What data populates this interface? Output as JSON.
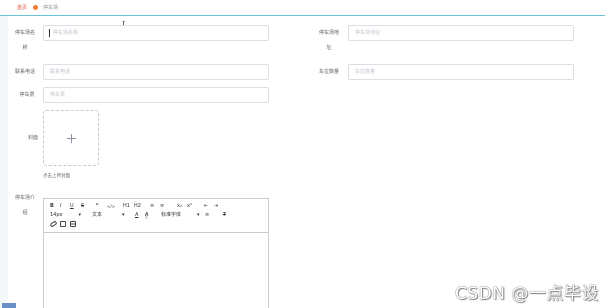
{
  "breadcrumb": {
    "home": "首页",
    "current": "停车场"
  },
  "cursor": "I",
  "form": {
    "name_label": "停车场名称",
    "name_label_line1": "停车场名",
    "name_label_line2": "称",
    "name_placeholder": "停车场名称",
    "addr_label_line1": "停车场地",
    "addr_label_line2": "址",
    "addr_placeholder": "停车场地址",
    "phone_label": "联系电话",
    "phone_placeholder": "联系电话",
    "spots_label": "车位数量",
    "spots_placeholder": "车位数量",
    "fee_label": "停车费",
    "fee_placeholder": "停车费",
    "cover_label": "封面",
    "cover_hint": "点击上传封面",
    "intro_label_line1": "停车场介",
    "intro_label_line2": "绍"
  },
  "editor_toolbar": {
    "bold": "B",
    "italic": "I",
    "underline": "U",
    "strike": "S",
    "quote": "❞",
    "code": "</>",
    "h1": "H1",
    "h2": "H2",
    "ordered": "≡",
    "bullet": "≡",
    "sub": "x₂",
    "sup": "x²",
    "outdent": "⇤",
    "indent": "⇥",
    "size": "14px",
    "header": "文本",
    "color": "A",
    "background": "A",
    "font": "标准字体",
    "align": "≡",
    "clean": "T̸"
  },
  "watermark": "CSDN @一点毕设"
}
